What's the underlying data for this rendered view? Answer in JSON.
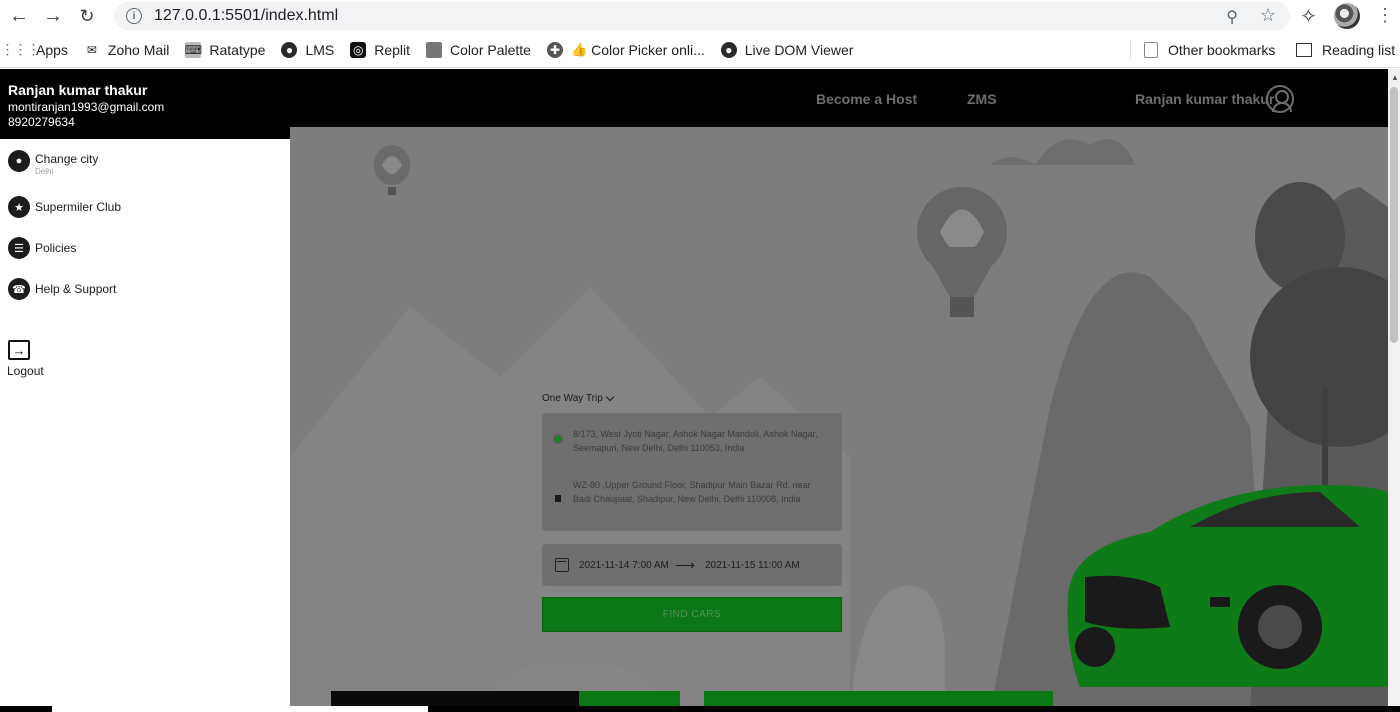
{
  "browser": {
    "url": "127.0.0.1:5501/index.html",
    "bookmarks": [
      {
        "label": "Apps",
        "icon": "apps-grid-icon"
      },
      {
        "label": "Zoho Mail",
        "icon": "zoho-mail-icon"
      },
      {
        "label": "Ratatype",
        "icon": "ratatype-icon"
      },
      {
        "label": "LMS",
        "icon": "globe-icon"
      },
      {
        "label": "Replit",
        "icon": "replit-icon"
      },
      {
        "label": "Color Palette",
        "icon": "color-palette-icon"
      },
      {
        "label": "Color Picker onli...",
        "icon": "color-picker-icon"
      },
      {
        "label": "Live DOM Viewer",
        "icon": "globe-icon"
      }
    ],
    "other_bookmarks": "Other bookmarks",
    "reading_list": "Reading list"
  },
  "topnav": {
    "links": [
      "Become a Host",
      "ZMS"
    ],
    "user_name": "Ranjan kumar thakur"
  },
  "sidebar": {
    "name": "Ranjan kumar thakur",
    "email": "montiranjan1993@gmail.com",
    "phone": "8920279634",
    "items": [
      {
        "label": "Change city",
        "sub": "Delhi",
        "icon": "location-pin-icon"
      },
      {
        "label": "Supermiler Club",
        "icon": "badge-icon"
      },
      {
        "label": "Policies",
        "icon": "document-icon"
      },
      {
        "label": "Help & Support",
        "icon": "phone-icon"
      }
    ],
    "logout": "Logout"
  },
  "booking": {
    "trip_type": "One Way Trip",
    "pickup": "8/173, West Jyoti Nagar, Ashok Nagar Mandoli, Ashok Nagar, Seemapuri, New Delhi, Delhi 110053, India",
    "drop": "WZ-80 ,Upper Ground Floor, Shadipur Main Bazar Rd, near Badi Chaupaal, Shadipur, New Delhi, Delhi 110008, India",
    "start": "2021-11-14 7:00 AM",
    "end": "2021-11-15 11:00 AM",
    "find_button": "FIND CARS"
  },
  "colors": {
    "accent_green": "#0c7715",
    "overlay": "#7a7a7a",
    "header": "#000000"
  }
}
